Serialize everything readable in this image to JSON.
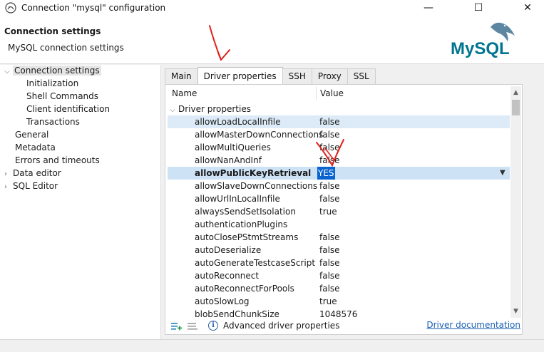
{
  "window": {
    "title": "Connection \"mysql\" configuration",
    "app_icon": "dbeaver-icon",
    "controls": {
      "minimize": "—",
      "maximize": "☐",
      "close": "✕"
    }
  },
  "header": {
    "title": "Connection settings",
    "subtitle": "MySQL connection settings",
    "logo": "MySQL"
  },
  "sidebar": {
    "items": [
      {
        "label": "Connection settings",
        "expanded": true,
        "selected": true
      },
      {
        "label": "Initialization"
      },
      {
        "label": "Shell Commands"
      },
      {
        "label": "Client identification"
      },
      {
        "label": "Transactions"
      },
      {
        "label": "General"
      },
      {
        "label": "Metadata"
      },
      {
        "label": "Errors and timeouts"
      },
      {
        "label": "Data editor",
        "collapsed": true
      },
      {
        "label": "SQL Editor",
        "collapsed": true
      }
    ]
  },
  "tabs": [
    {
      "label": "Main"
    },
    {
      "label": "Driver properties",
      "active": true
    },
    {
      "label": "SSH"
    },
    {
      "label": "Proxy"
    },
    {
      "label": "SSL"
    }
  ],
  "grid": {
    "columns": {
      "name": "Name",
      "value": "Value"
    },
    "group": "Driver properties",
    "rows": [
      {
        "name": "allowLoadLocalInfile",
        "value": "false"
      },
      {
        "name": "allowMasterDownConnections",
        "value": "false"
      },
      {
        "name": "allowMultiQueries",
        "value": "false"
      },
      {
        "name": "allowNanAndInf",
        "value": "false"
      },
      {
        "name": "allowPublicKeyRetrieval",
        "value": "YES"
      },
      {
        "name": "allowSlaveDownConnections",
        "value": "false"
      },
      {
        "name": "allowUrlInLocalInfile",
        "value": "false"
      },
      {
        "name": "alwaysSendSetIsolation",
        "value": "true"
      },
      {
        "name": "authenticationPlugins",
        "value": ""
      },
      {
        "name": "autoClosePStmtStreams",
        "value": "false"
      },
      {
        "name": "autoDeserialize",
        "value": "false"
      },
      {
        "name": "autoGenerateTestcaseScript",
        "value": "false"
      },
      {
        "name": "autoReconnect",
        "value": "false"
      },
      {
        "name": "autoReconnectForPools",
        "value": "false"
      },
      {
        "name": "autoSlowLog",
        "value": "true"
      },
      {
        "name": "blobSendChunkSize",
        "value": "1048576"
      }
    ]
  },
  "footer": {
    "advanced_label": "Advanced driver properties",
    "doc_link": "Driver documentation"
  },
  "colors": {
    "selection": "#0a64d0",
    "row_highlight": "#dcebf7",
    "link": "#1a5fb4",
    "annotation": "#e0201b"
  }
}
